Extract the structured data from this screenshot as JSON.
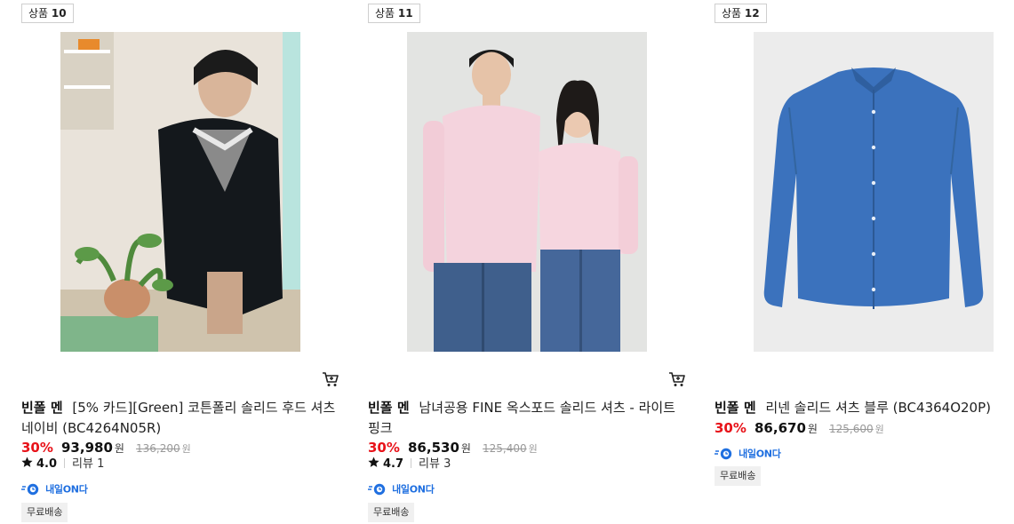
{
  "products": [
    {
      "label_prefix": "상품",
      "label_number": "10",
      "image_icon": "product-photo-man-dark-shirt-plant",
      "brand": "빈폴 멘",
      "name": "[5% 카드][Green] 코튼폴리 솔리드 후드 셔츠 네이비 (BC4264N05R)",
      "discount": "30%",
      "price": "93,980",
      "currency": "원",
      "original_price": "136,200",
      "original_currency": "원",
      "rating": "4.0",
      "reviews": "리뷰 1",
      "delivery": "내일ON다",
      "free_shipping": "무료배송"
    },
    {
      "label_prefix": "상품",
      "label_number": "11",
      "image_icon": "product-photo-couple-pink-shirts",
      "brand": "빈폴 멘",
      "name": "남녀공용 FINE 옥스포드 솔리드 셔츠 - 라이트 핑크",
      "discount": "30%",
      "price": "86,530",
      "currency": "원",
      "original_price": "125,400",
      "original_currency": "원",
      "rating": "4.7",
      "reviews": "리뷰 3",
      "delivery": "내일ON다",
      "free_shipping": "무료배송"
    },
    {
      "label_prefix": "상품",
      "label_number": "12",
      "image_icon": "product-photo-blue-linen-shirt",
      "brand": "빈폴 멘",
      "name": "리넨 솔리드 셔츠 블루 (BC4364O20P)",
      "discount": "30%",
      "price": "86,670",
      "currency": "원",
      "original_price": "125,600",
      "original_currency": "원",
      "delivery": "내일ON다",
      "free_shipping": "무료배송"
    }
  ],
  "icons": {
    "cart": "cart-icon",
    "star": "star-icon",
    "delivery": "delivery-truck-icon"
  },
  "colors": {
    "discount": "#e8131a",
    "delivery_brand": "#1f6fe0",
    "badge_bg": "#f0f0f0"
  }
}
